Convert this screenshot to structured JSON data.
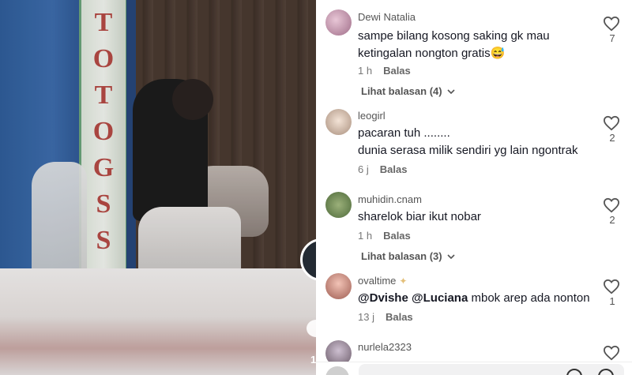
{
  "video": {
    "pillar_letters": [
      "T",
      "O",
      "T",
      "O",
      "G",
      "S",
      "S"
    ],
    "like_count_peek": "1"
  },
  "comments": [
    {
      "username": "Dewi Natalia",
      "text": "sampe bilang kosong saking gk mau ketingalan nongton gratis😅",
      "time": "1 h",
      "reply_label": "Balas",
      "likes": "7",
      "view_replies": "Lihat balasan (4)",
      "avatar_color": "#c89bb0"
    },
    {
      "username": "leogirl",
      "text_line1": "pacaran tuh ........",
      "text_line2": "dunia serasa milik sendiri yg lain ngontrak",
      "time": "6 j",
      "reply_label": "Balas",
      "likes": "2",
      "avatar_color": "#d9c7b9"
    },
    {
      "username": "muhidin.cnam",
      "text": "sharelok biar ikut nobar",
      "time": "1 h",
      "reply_label": "Balas",
      "likes": "2",
      "view_replies": "Lihat balasan (3)",
      "avatar_color": "#6f8a55"
    },
    {
      "username": "ovaltime",
      "mention1": "@Dvishe",
      "mention2": "@Luciana",
      "text_rest": "mbok arep ada nonton",
      "time": "13 j",
      "reply_label": "Balas",
      "likes": "1",
      "avatar_color": "#c78a7a"
    },
    {
      "username": "nurlela2323",
      "avatar_color": "#8f7e8a"
    }
  ],
  "colors": {
    "text_primary": "#161823",
    "text_secondary": "#777777"
  }
}
